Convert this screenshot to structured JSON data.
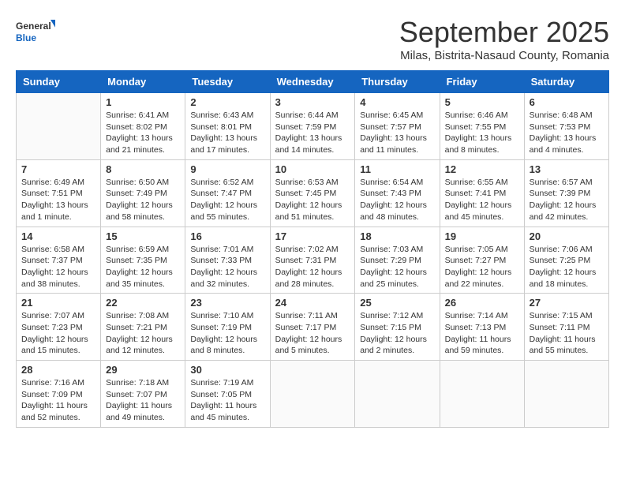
{
  "header": {
    "logo_general": "General",
    "logo_blue": "Blue",
    "month_title": "September 2025",
    "subtitle": "Milas, Bistrita-Nasaud County, Romania"
  },
  "days_of_week": [
    "Sunday",
    "Monday",
    "Tuesday",
    "Wednesday",
    "Thursday",
    "Friday",
    "Saturday"
  ],
  "weeks": [
    [
      {
        "day": "",
        "sunrise": "",
        "sunset": "",
        "daylight": ""
      },
      {
        "day": "1",
        "sunrise": "Sunrise: 6:41 AM",
        "sunset": "Sunset: 8:02 PM",
        "daylight": "Daylight: 13 hours and 21 minutes."
      },
      {
        "day": "2",
        "sunrise": "Sunrise: 6:43 AM",
        "sunset": "Sunset: 8:01 PM",
        "daylight": "Daylight: 13 hours and 17 minutes."
      },
      {
        "day": "3",
        "sunrise": "Sunrise: 6:44 AM",
        "sunset": "Sunset: 7:59 PM",
        "daylight": "Daylight: 13 hours and 14 minutes."
      },
      {
        "day": "4",
        "sunrise": "Sunrise: 6:45 AM",
        "sunset": "Sunset: 7:57 PM",
        "daylight": "Daylight: 13 hours and 11 minutes."
      },
      {
        "day": "5",
        "sunrise": "Sunrise: 6:46 AM",
        "sunset": "Sunset: 7:55 PM",
        "daylight": "Daylight: 13 hours and 8 minutes."
      },
      {
        "day": "6",
        "sunrise": "Sunrise: 6:48 AM",
        "sunset": "Sunset: 7:53 PM",
        "daylight": "Daylight: 13 hours and 4 minutes."
      }
    ],
    [
      {
        "day": "7",
        "sunrise": "Sunrise: 6:49 AM",
        "sunset": "Sunset: 7:51 PM",
        "daylight": "Daylight: 13 hours and 1 minute."
      },
      {
        "day": "8",
        "sunrise": "Sunrise: 6:50 AM",
        "sunset": "Sunset: 7:49 PM",
        "daylight": "Daylight: 12 hours and 58 minutes."
      },
      {
        "day": "9",
        "sunrise": "Sunrise: 6:52 AM",
        "sunset": "Sunset: 7:47 PM",
        "daylight": "Daylight: 12 hours and 55 minutes."
      },
      {
        "day": "10",
        "sunrise": "Sunrise: 6:53 AM",
        "sunset": "Sunset: 7:45 PM",
        "daylight": "Daylight: 12 hours and 51 minutes."
      },
      {
        "day": "11",
        "sunrise": "Sunrise: 6:54 AM",
        "sunset": "Sunset: 7:43 PM",
        "daylight": "Daylight: 12 hours and 48 minutes."
      },
      {
        "day": "12",
        "sunrise": "Sunrise: 6:55 AM",
        "sunset": "Sunset: 7:41 PM",
        "daylight": "Daylight: 12 hours and 45 minutes."
      },
      {
        "day": "13",
        "sunrise": "Sunrise: 6:57 AM",
        "sunset": "Sunset: 7:39 PM",
        "daylight": "Daylight: 12 hours and 42 minutes."
      }
    ],
    [
      {
        "day": "14",
        "sunrise": "Sunrise: 6:58 AM",
        "sunset": "Sunset: 7:37 PM",
        "daylight": "Daylight: 12 hours and 38 minutes."
      },
      {
        "day": "15",
        "sunrise": "Sunrise: 6:59 AM",
        "sunset": "Sunset: 7:35 PM",
        "daylight": "Daylight: 12 hours and 35 minutes."
      },
      {
        "day": "16",
        "sunrise": "Sunrise: 7:01 AM",
        "sunset": "Sunset: 7:33 PM",
        "daylight": "Daylight: 12 hours and 32 minutes."
      },
      {
        "day": "17",
        "sunrise": "Sunrise: 7:02 AM",
        "sunset": "Sunset: 7:31 PM",
        "daylight": "Daylight: 12 hours and 28 minutes."
      },
      {
        "day": "18",
        "sunrise": "Sunrise: 7:03 AM",
        "sunset": "Sunset: 7:29 PM",
        "daylight": "Daylight: 12 hours and 25 minutes."
      },
      {
        "day": "19",
        "sunrise": "Sunrise: 7:05 AM",
        "sunset": "Sunset: 7:27 PM",
        "daylight": "Daylight: 12 hours and 22 minutes."
      },
      {
        "day": "20",
        "sunrise": "Sunrise: 7:06 AM",
        "sunset": "Sunset: 7:25 PM",
        "daylight": "Daylight: 12 hours and 18 minutes."
      }
    ],
    [
      {
        "day": "21",
        "sunrise": "Sunrise: 7:07 AM",
        "sunset": "Sunset: 7:23 PM",
        "daylight": "Daylight: 12 hours and 15 minutes."
      },
      {
        "day": "22",
        "sunrise": "Sunrise: 7:08 AM",
        "sunset": "Sunset: 7:21 PM",
        "daylight": "Daylight: 12 hours and 12 minutes."
      },
      {
        "day": "23",
        "sunrise": "Sunrise: 7:10 AM",
        "sunset": "Sunset: 7:19 PM",
        "daylight": "Daylight: 12 hours and 8 minutes."
      },
      {
        "day": "24",
        "sunrise": "Sunrise: 7:11 AM",
        "sunset": "Sunset: 7:17 PM",
        "daylight": "Daylight: 12 hours and 5 minutes."
      },
      {
        "day": "25",
        "sunrise": "Sunrise: 7:12 AM",
        "sunset": "Sunset: 7:15 PM",
        "daylight": "Daylight: 12 hours and 2 minutes."
      },
      {
        "day": "26",
        "sunrise": "Sunrise: 7:14 AM",
        "sunset": "Sunset: 7:13 PM",
        "daylight": "Daylight: 11 hours and 59 minutes."
      },
      {
        "day": "27",
        "sunrise": "Sunrise: 7:15 AM",
        "sunset": "Sunset: 7:11 PM",
        "daylight": "Daylight: 11 hours and 55 minutes."
      }
    ],
    [
      {
        "day": "28",
        "sunrise": "Sunrise: 7:16 AM",
        "sunset": "Sunset: 7:09 PM",
        "daylight": "Daylight: 11 hours and 52 minutes."
      },
      {
        "day": "29",
        "sunrise": "Sunrise: 7:18 AM",
        "sunset": "Sunset: 7:07 PM",
        "daylight": "Daylight: 11 hours and 49 minutes."
      },
      {
        "day": "30",
        "sunrise": "Sunrise: 7:19 AM",
        "sunset": "Sunset: 7:05 PM",
        "daylight": "Daylight: 11 hours and 45 minutes."
      },
      {
        "day": "",
        "sunrise": "",
        "sunset": "",
        "daylight": ""
      },
      {
        "day": "",
        "sunrise": "",
        "sunset": "",
        "daylight": ""
      },
      {
        "day": "",
        "sunrise": "",
        "sunset": "",
        "daylight": ""
      },
      {
        "day": "",
        "sunrise": "",
        "sunset": "",
        "daylight": ""
      }
    ]
  ]
}
